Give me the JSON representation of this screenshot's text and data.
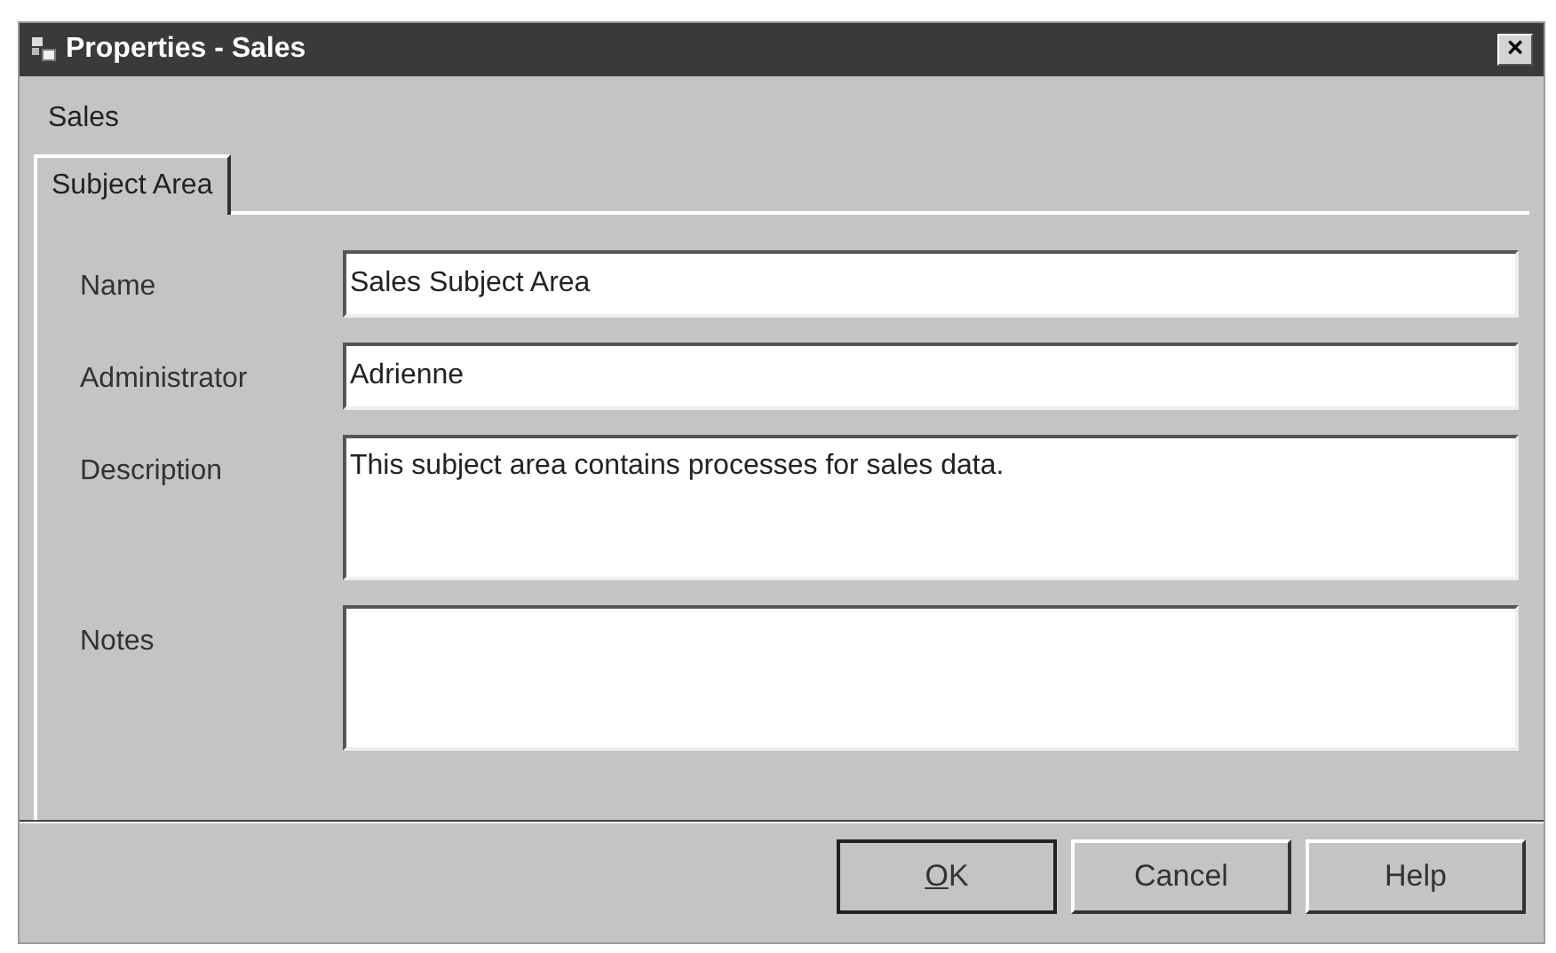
{
  "window": {
    "title": "Properties - Sales",
    "close": "×"
  },
  "heading": "Sales",
  "tabs": [
    {
      "label": "Subject Area",
      "selected": true
    }
  ],
  "fields": [
    {
      "label": "Name",
      "kind": "line",
      "value": "Sales Subject Area"
    },
    {
      "label": "Administrator",
      "kind": "line",
      "value": "Adrienne"
    },
    {
      "label": "Description",
      "kind": "area",
      "value": "This subject area contains processes for sales data."
    },
    {
      "label": "Notes",
      "kind": "area"
    }
  ],
  "buttons": [
    {
      "label": "OK",
      "default": true,
      "access_key_underlined": true
    },
    {
      "label": "Cancel",
      "default": false,
      "access_key_underlined": false
    },
    {
      "label": "Help",
      "default": false,
      "access_key_underlined": false
    }
  ]
}
